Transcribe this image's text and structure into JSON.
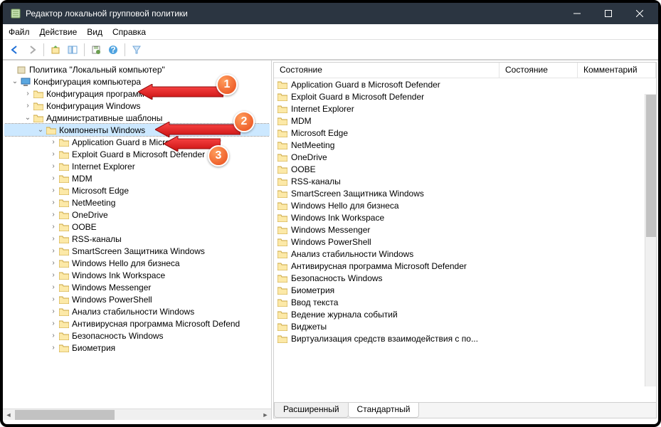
{
  "window": {
    "title": "Редактор локальной групповой политики"
  },
  "menu": {
    "file": "Файл",
    "action": "Действие",
    "view": "Вид",
    "help": "Справка"
  },
  "tree": {
    "root": "Политика \"Локальный компьютер\"",
    "computer_config": "Конфигурация компьютера",
    "prog_config": "Конфигурация программ",
    "win_config": "Конфигурация Windows",
    "admin_templates": "Административные шаблоны",
    "win_components": "Компоненты Windows",
    "items": [
      "Application Guard в Microsoft Defender",
      "Exploit Guard в Microsoft Defender",
      "Internet Explorer",
      "MDM",
      "Microsoft Edge",
      "NetMeeting",
      "OneDrive",
      "OOBE",
      "RSS-каналы",
      "SmartScreen Защитника Windows",
      "Windows Hello для бизнеса",
      "Windows Ink Workspace",
      "Windows Messenger",
      "Windows PowerShell",
      "Анализ стабильности Windows",
      "Антивирусная программа Microsoft Defend",
      "Безопасность Windows",
      "Биометрия"
    ]
  },
  "list": {
    "col_state": "Состояние",
    "col_status": "Состояние",
    "col_comment": "Комментарий",
    "items": [
      "Application Guard в Microsoft Defender",
      "Exploit Guard в Microsoft Defender",
      "Internet Explorer",
      "MDM",
      "Microsoft Edge",
      "NetMeeting",
      "OneDrive",
      "OOBE",
      "RSS-каналы",
      "SmartScreen Защитника Windows",
      "Windows Hello для бизнеса",
      "Windows Ink Workspace",
      "Windows Messenger",
      "Windows PowerShell",
      "Анализ стабильности Windows",
      "Антивирусная программа Microsoft Defender",
      "Безопасность Windows",
      "Биометрия",
      "Ввод текста",
      "Ведение журнала событий",
      "Виджеты",
      "Виртуализация средств взаимодействия с по..."
    ],
    "tabs": {
      "extended": "Расширенный",
      "standard": "Стандартный"
    }
  },
  "annot": {
    "n1": "1",
    "n2": "2",
    "n3": "3"
  }
}
